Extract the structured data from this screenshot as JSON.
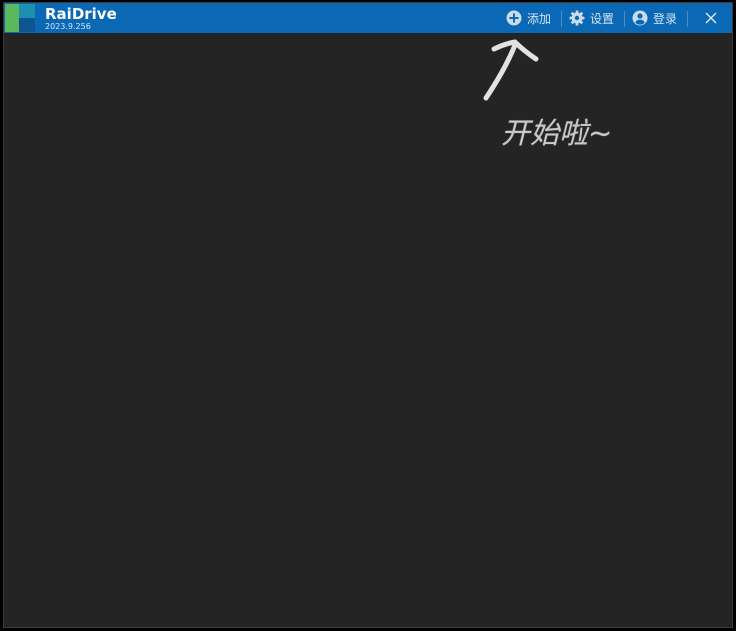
{
  "app": {
    "title": "RaiDrive",
    "version": "2023.9.256"
  },
  "toolbar": {
    "add_label": "添加",
    "settings_label": "设置",
    "login_label": "登录"
  },
  "annotation": {
    "text": "开始啦~"
  },
  "colors": {
    "titlebar": "#0a68b5",
    "background": "#242424",
    "logo_green": "#5cb85c",
    "logo_teal": "#1e8fb0",
    "logo_dark": "#0f5590"
  },
  "icons": [
    "plus-circle-icon",
    "gear-icon",
    "user-circle-icon",
    "close-icon"
  ]
}
